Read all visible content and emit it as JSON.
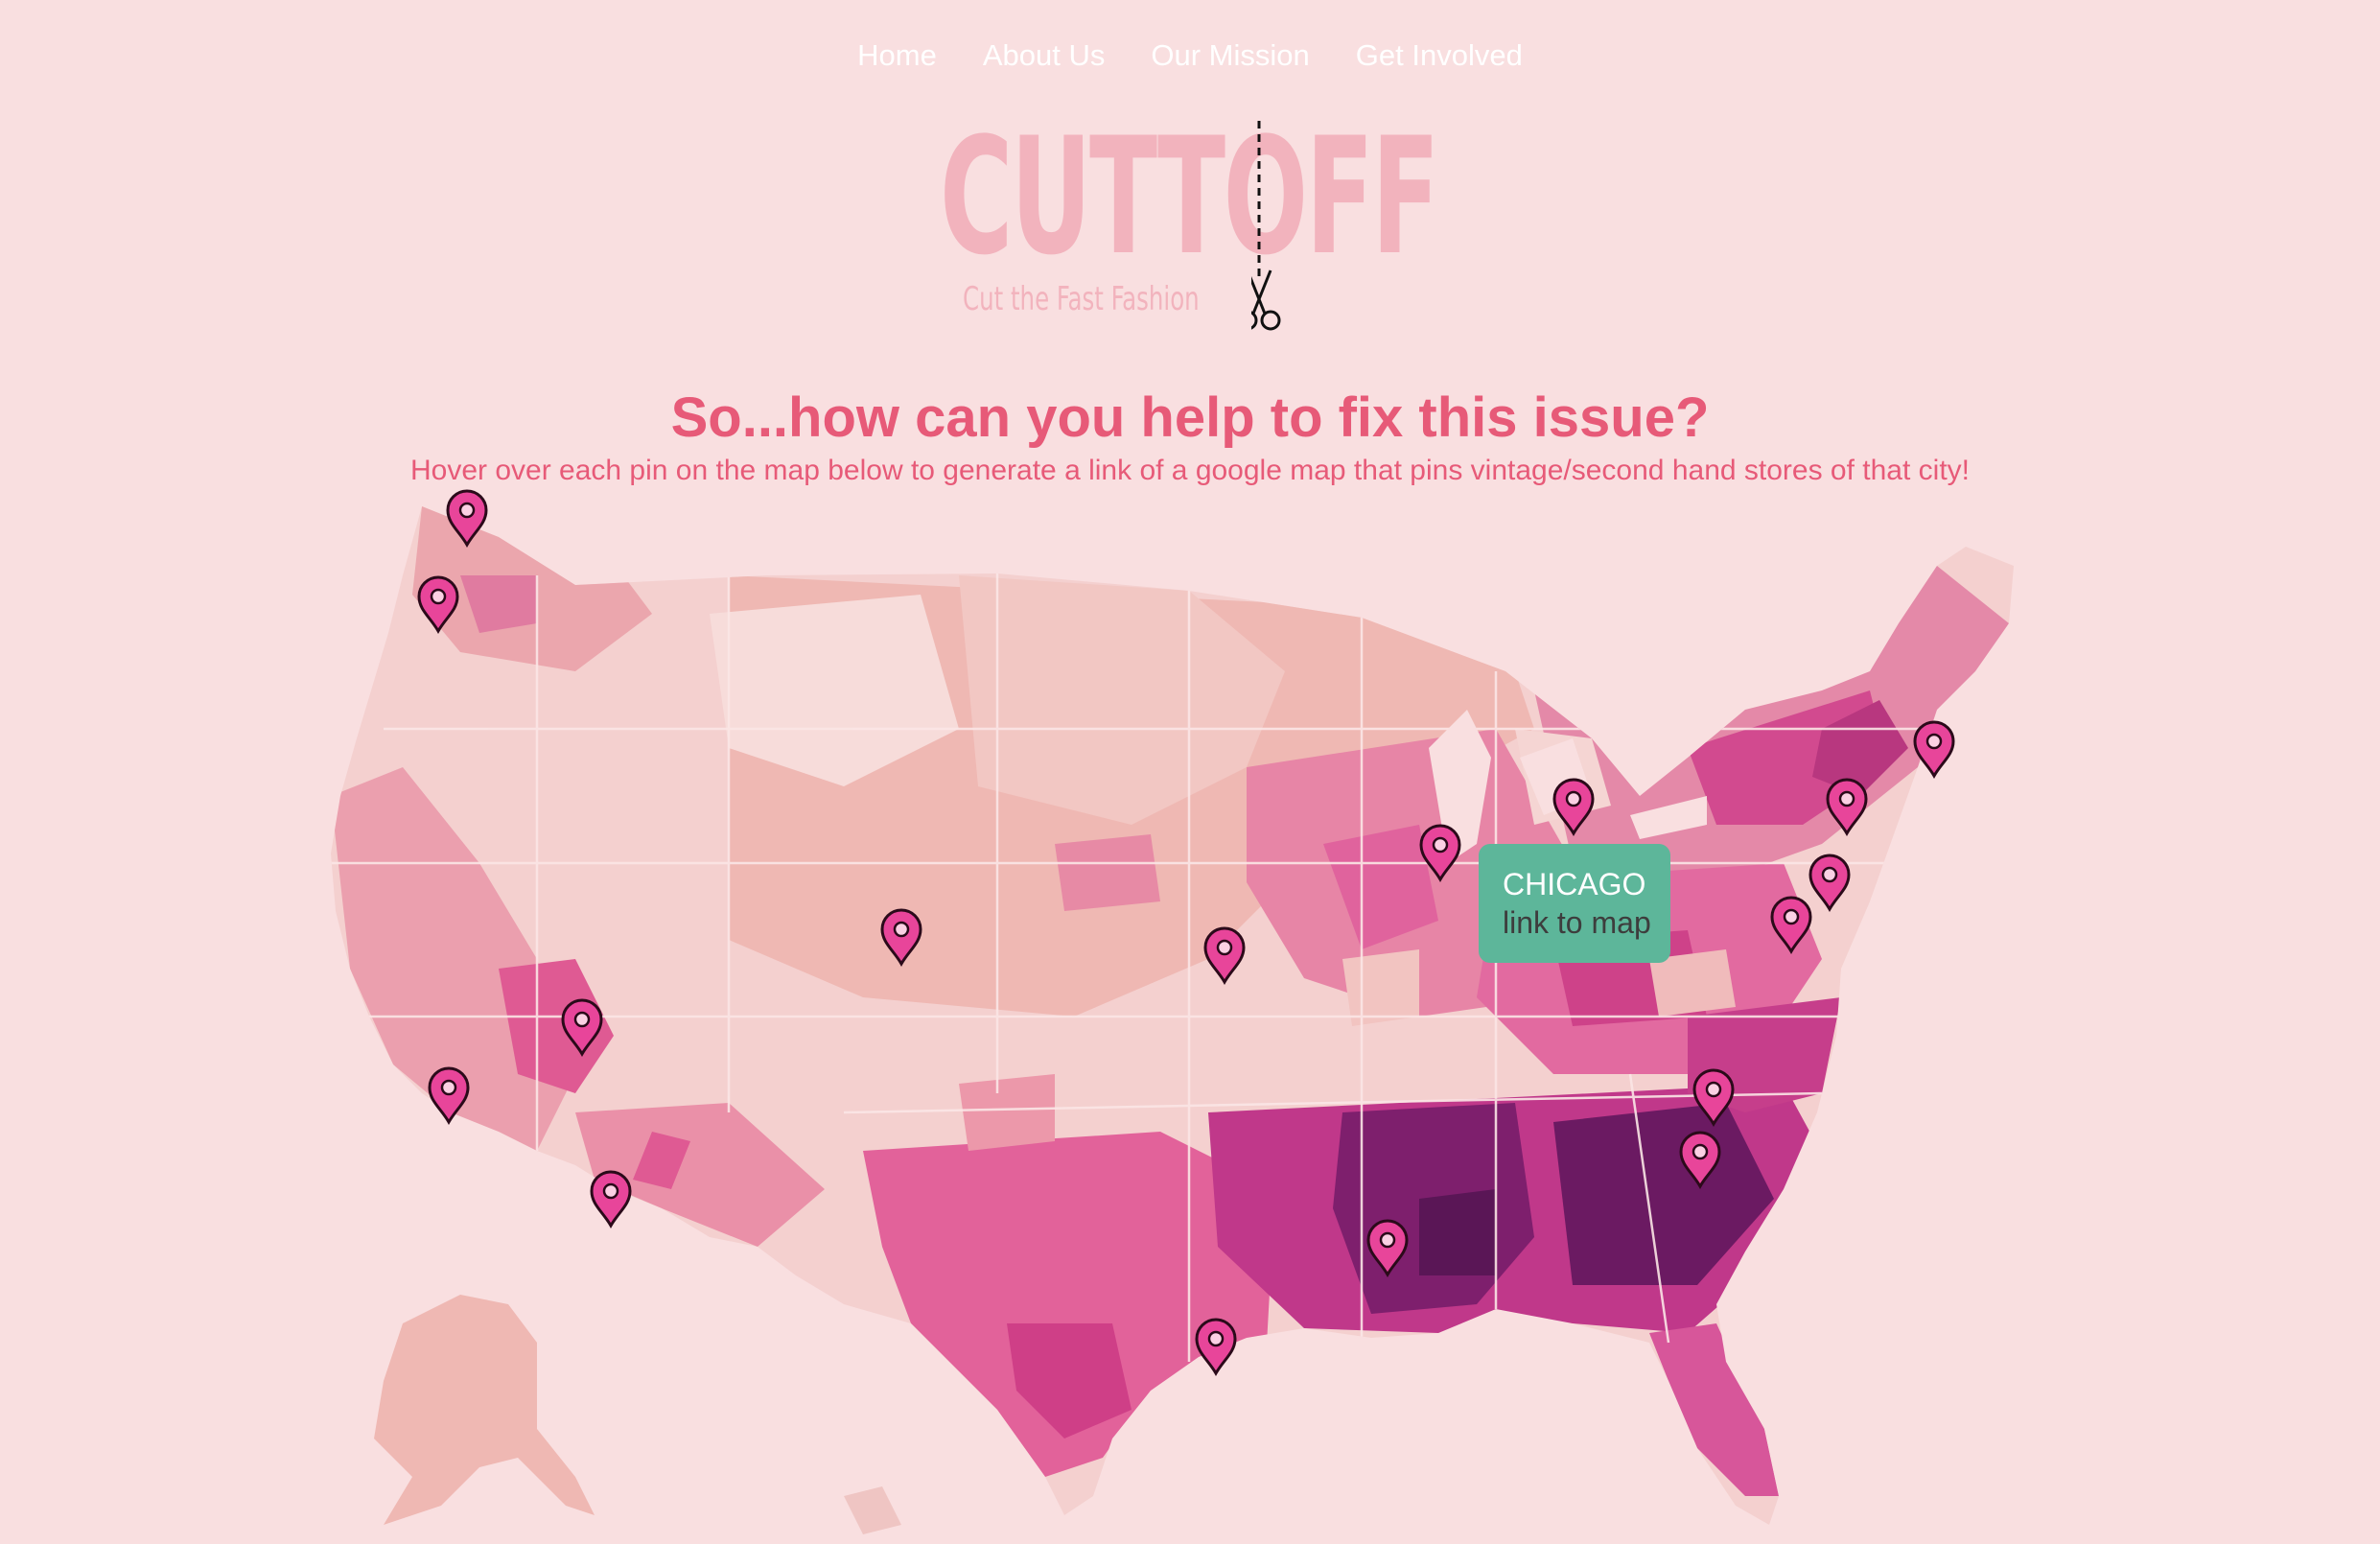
{
  "nav": {
    "items": [
      {
        "label": "Home"
      },
      {
        "label": "About Us"
      },
      {
        "label": "Our Mission"
      },
      {
        "label": "Get Involved"
      }
    ]
  },
  "logo": {
    "wordmark": "CUTTOFF",
    "tagline": "Cut the Fast Fashion",
    "icon": "scissors-icon"
  },
  "main": {
    "heading": "So...how can you help to fix this issue?",
    "subheading": "Hover over each pin on the map below to generate a link of a google map that pins vintage/second hand stores of that city!"
  },
  "map": {
    "pin_icon": "map-pin-icon",
    "pin_color": "#e8459a",
    "tooltip": {
      "city": "CHICAGO",
      "link_label": "link to map",
      "color": "#5db69a"
    }
  },
  "colors": {
    "background": "#f9dfe0",
    "accent": "#e75a78",
    "logo": "#f2b3bd"
  }
}
